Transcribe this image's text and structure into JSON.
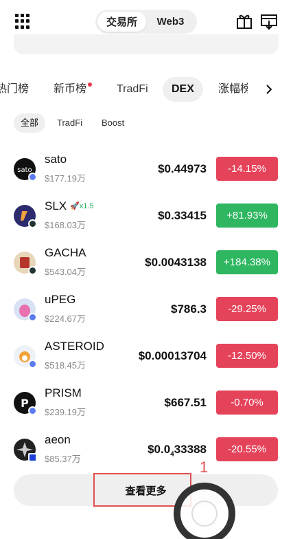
{
  "header": {
    "exchange_label": "交易所",
    "web3_label": "Web3",
    "menu_icon": "grid-menu-icon",
    "gift_icon": "gift-icon",
    "download_icon": "download-icon"
  },
  "tabs": [
    {
      "label": "热门榜"
    },
    {
      "label": "新币榜"
    },
    {
      "label": "TradFi"
    },
    {
      "label": "DEX"
    },
    {
      "label": "涨幅榜"
    }
  ],
  "subtabs": [
    {
      "label": "全部"
    },
    {
      "label": "TradFi"
    },
    {
      "label": "Boost"
    }
  ],
  "tokens": [
    {
      "name": "sato",
      "volume": "$177.19万",
      "price": "$0.44973",
      "change": "-14.15%",
      "direction": "down"
    },
    {
      "name": "SLX",
      "boost": "x1.5",
      "volume": "$168.03万",
      "price": "$0.33415",
      "change": "+81.93%",
      "direction": "up"
    },
    {
      "name": "GACHA",
      "volume": "$543.04万",
      "price": "$0.0043138",
      "change": "+184.38%",
      "direction": "up"
    },
    {
      "name": "uPEG",
      "volume": "$224.67万",
      "price": "$786.3",
      "change": "-29.25%",
      "direction": "down"
    },
    {
      "name": "ASTEROID",
      "volume": "$518.45万",
      "price": "$0.00013704",
      "change": "-12.50%",
      "direction": "down"
    },
    {
      "name": "PRISM",
      "volume": "$239.19万",
      "price": "$667.51",
      "change": "-0.70%",
      "direction": "down"
    },
    {
      "name": "aeon",
      "volume": "$85.37万",
      "price_prefix": "$0.0",
      "price_sub": "4",
      "price_suffix": "33388",
      "change": "-20.55%",
      "direction": "down"
    }
  ],
  "more_label": "查看更多",
  "annotation_number": "1",
  "colors": {
    "up": "#2eb660",
    "down": "#e5435a",
    "highlight": "#e05050"
  }
}
